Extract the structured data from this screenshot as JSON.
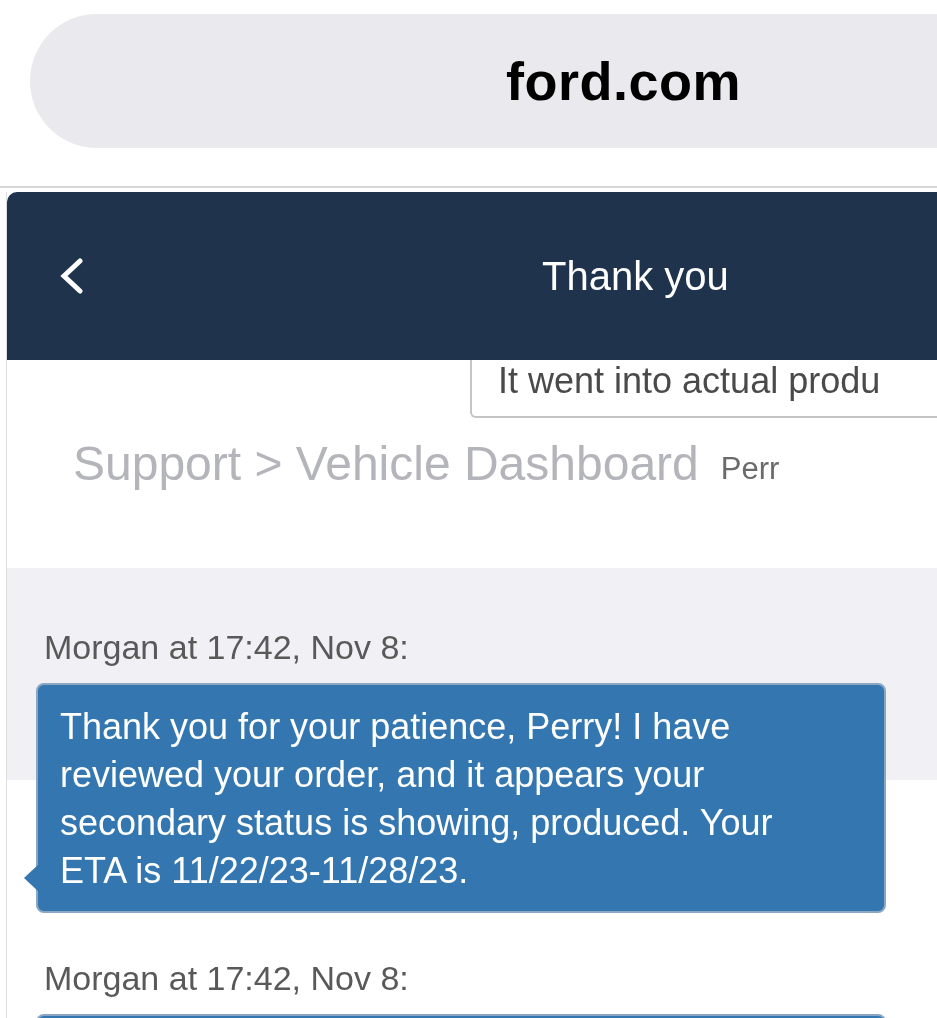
{
  "address_bar": {
    "url": "ford.com"
  },
  "header": {
    "title": "Thank you"
  },
  "background_breadcrumb": "Support > Vehicle Dashboard",
  "outgoing_message": {
    "text": "It went into actual produ",
    "sender": "Perr"
  },
  "messages": [
    {
      "sender": "Morgan at 17:42, Nov 8:",
      "text": "Thank you for your patience, Perry! I have reviewed your order, and it appears your secondary status is showing, produced. Your ETA is 11/22/23-11/28/23."
    },
    {
      "sender": "Morgan at 17:42, Nov 8:"
    }
  ]
}
